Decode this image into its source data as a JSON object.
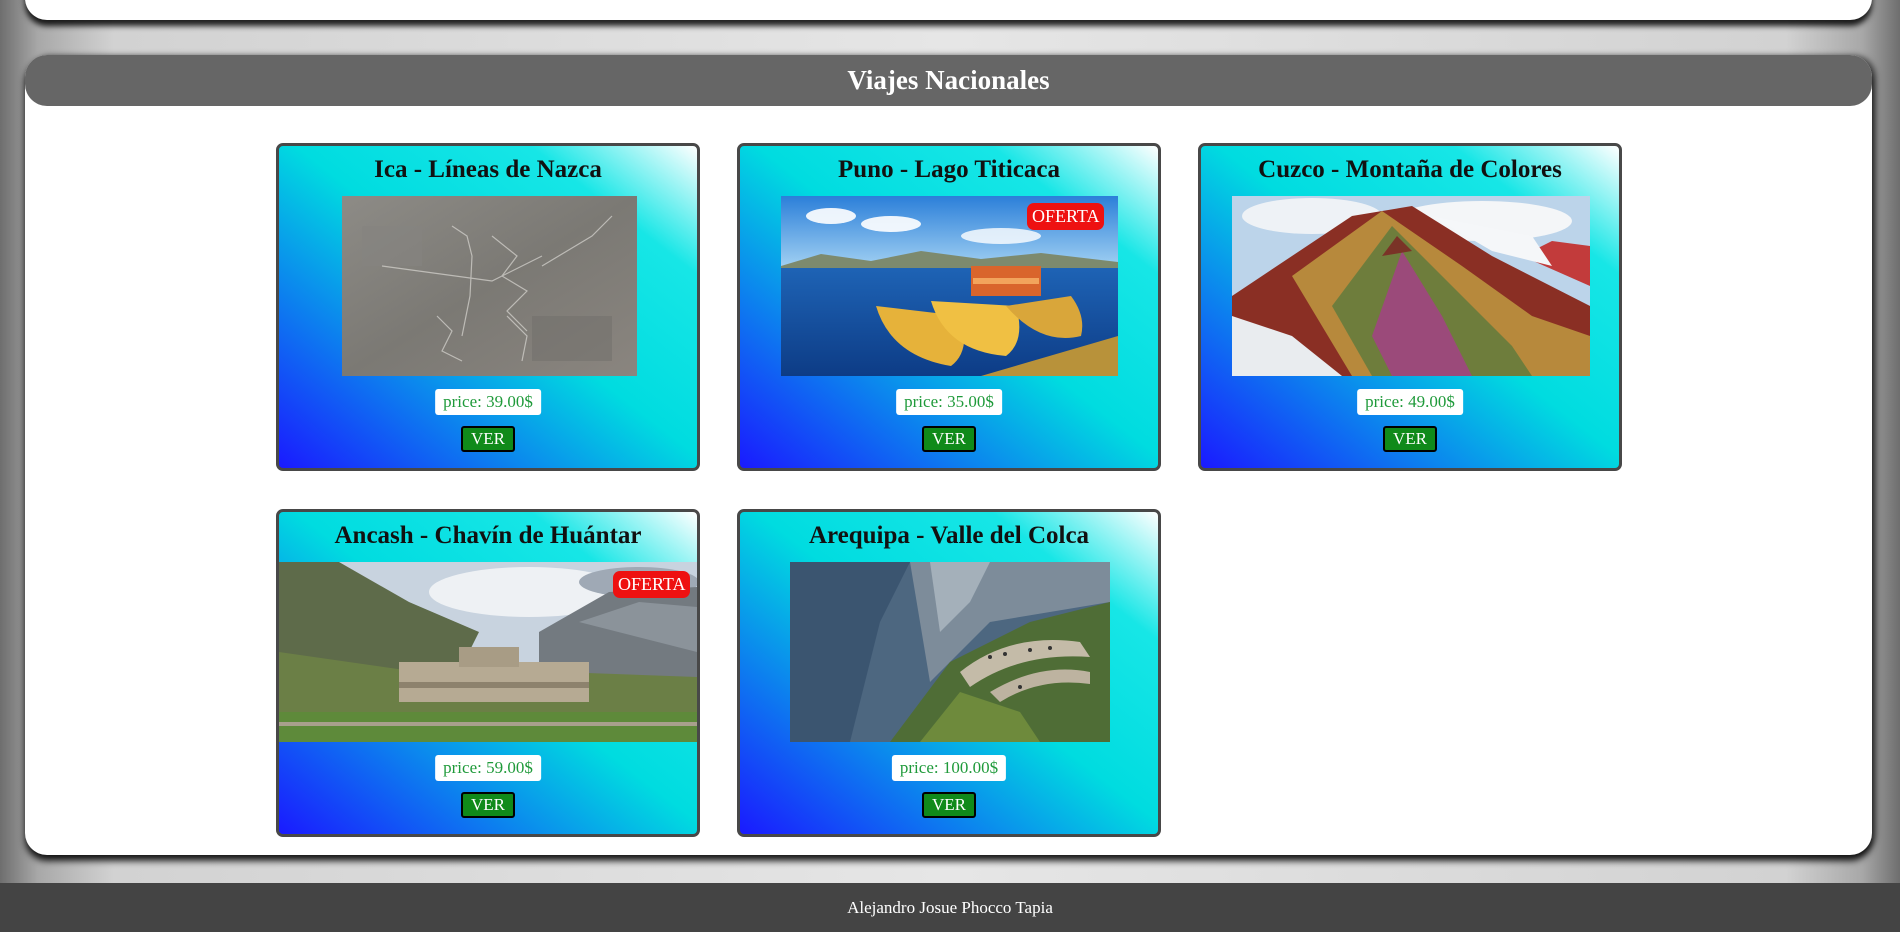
{
  "section": {
    "title": "Viajes Nacionales"
  },
  "cards": [
    {
      "title": "Ica - Líneas de Nazca",
      "price": "price: 39.00$",
      "button": "VER",
      "badge": ""
    },
    {
      "title": "Puno - Lago Titicaca",
      "price": "price: 35.00$",
      "button": "VER",
      "badge": "OFERTA"
    },
    {
      "title": "Cuzco - Montaña de Colores",
      "price": "price: 49.00$",
      "button": "VER",
      "badge": ""
    },
    {
      "title": "Ancash - Chavín de Huántar",
      "price": "price: 59.00$",
      "button": "VER",
      "badge": "OFERTA"
    },
    {
      "title": "Arequipa - Valle del Colca",
      "price": "price: 100.00$",
      "button": "VER",
      "badge": ""
    }
  ],
  "footer": {
    "text": "Alejandro Josue Phocco Tapia"
  },
  "colors": {
    "header_bg": "#666666",
    "badge_bg": "#ee1111",
    "button_bg": "#108a1a",
    "price_text": "#1f9a3a",
    "footer_bg": "#444444"
  }
}
